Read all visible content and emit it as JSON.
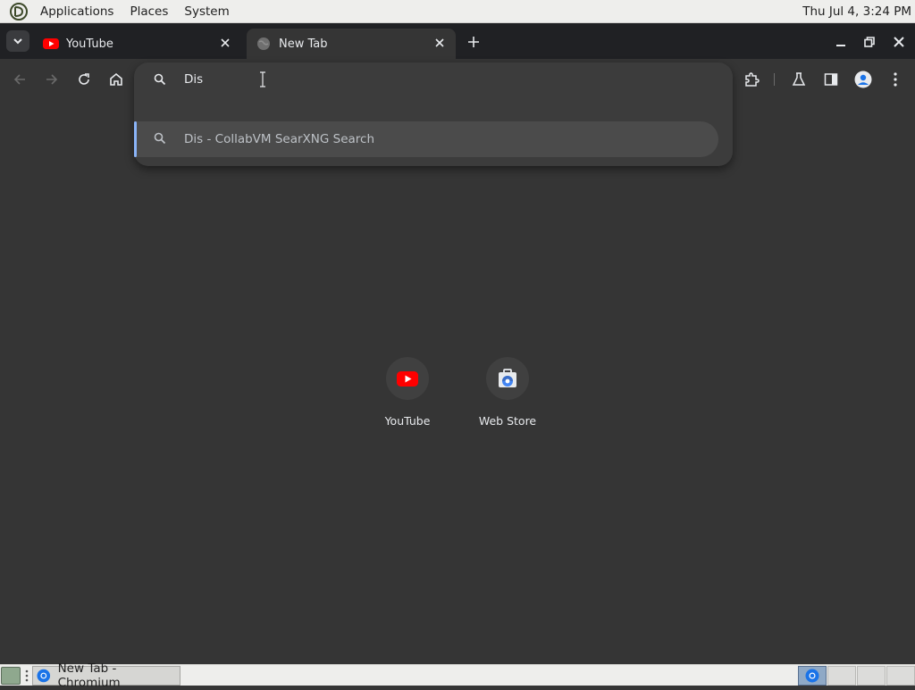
{
  "panel": {
    "menus": [
      "Applications",
      "Places",
      "System"
    ],
    "clock": "Thu Jul  4,  3:24 PM"
  },
  "tabs": [
    {
      "title": "YouTube",
      "icon": "youtube-icon",
      "active": false
    },
    {
      "title": "New Tab",
      "icon": "globe-icon",
      "active": true
    }
  ],
  "omnibox": {
    "value": "Dis",
    "suggestion": {
      "typed": "Dis",
      "rest": " - CollabVM SearXNG Search"
    }
  },
  "shortcuts": [
    {
      "label": "YouTube",
      "icon": "youtube-icon"
    },
    {
      "label": "Web Store",
      "icon": "web-store-icon"
    }
  ],
  "taskbar": {
    "task_label": "New Tab - Chromium"
  },
  "colors": {
    "tabstrip": "#202124",
    "content": "#353535",
    "accent": "#8ab4f8",
    "youtube_red": "#ff0000"
  }
}
